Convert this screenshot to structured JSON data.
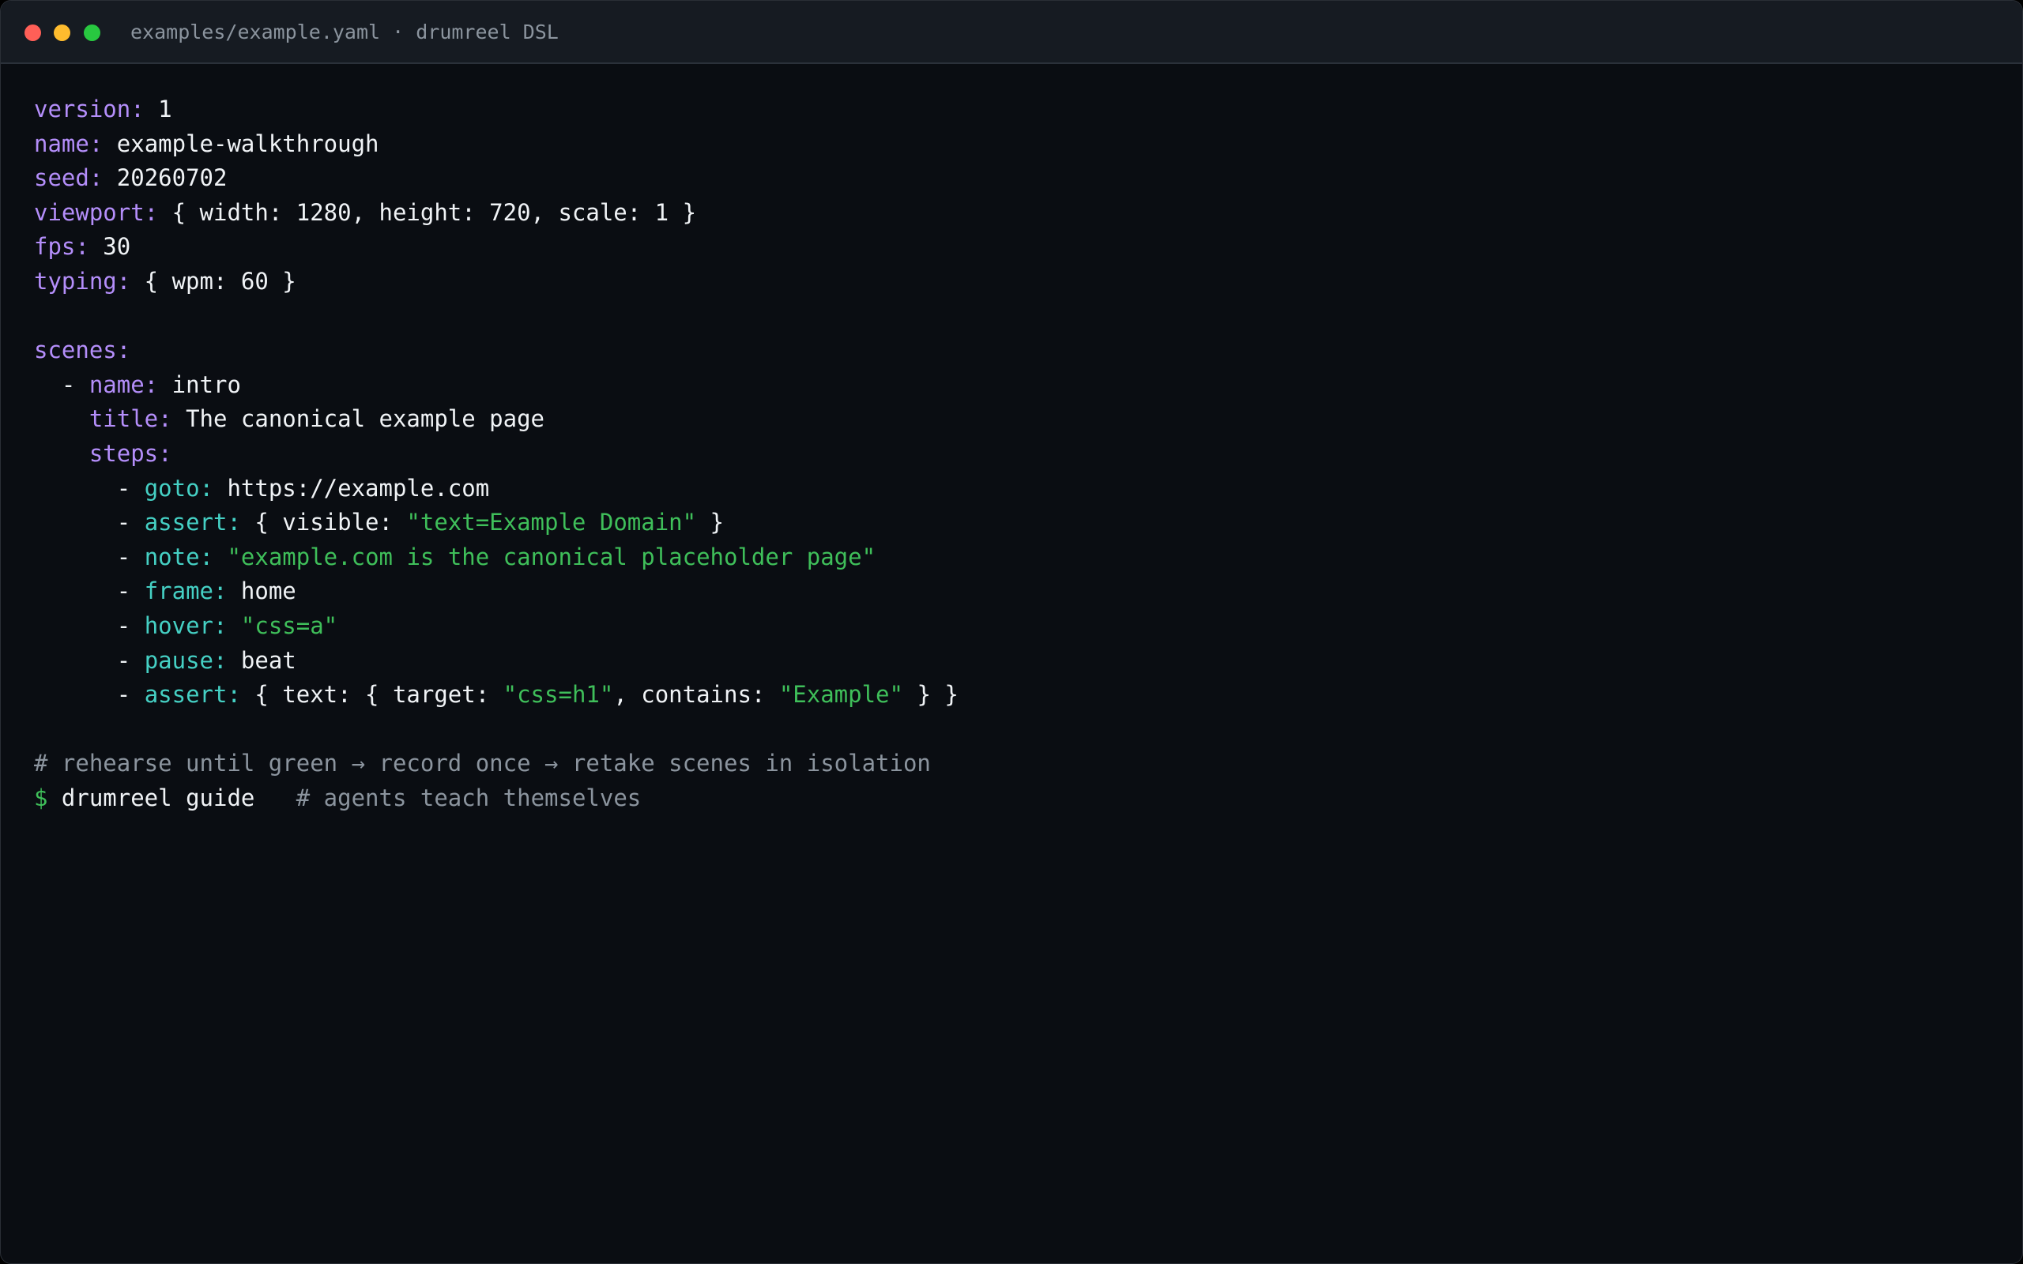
{
  "window": {
    "title": "examples/example.yaml · drumreel DSL"
  },
  "colors": {
    "background": "#0a0d12",
    "titlebar": "#161b22",
    "key": "#b48efa",
    "step_key": "#45d0c4",
    "string": "#3fbf5a",
    "value": "#f0f3f6",
    "comment": "#8b949e",
    "prompt": "#3fbf5a"
  },
  "lines": [
    {
      "indent": "",
      "key": "version:",
      "value": " 1"
    },
    {
      "indent": "",
      "key": "name:",
      "value": " example-walkthrough"
    },
    {
      "indent": "",
      "key": "seed:",
      "value": " 20260702"
    },
    {
      "indent": "",
      "key": "viewport:",
      "value": " { width: 1280, height: 720, scale: 1 }"
    },
    {
      "indent": "",
      "key": "fps:",
      "value": " 30"
    },
    {
      "indent": "",
      "key": "typing:",
      "value": " { wpm: 60 }"
    },
    {
      "blank": ""
    },
    {
      "indent": "",
      "key": "scenes:"
    },
    {
      "indent": "  - ",
      "key": "name:",
      "value": " intro"
    },
    {
      "indent": "    ",
      "key": "title:",
      "value": " The canonical example page"
    },
    {
      "indent": "    ",
      "key": "steps:"
    },
    {
      "indent": "      - ",
      "step": "goto:",
      "value": " https://example.com"
    },
    {
      "indent": "      - ",
      "step": "assert:",
      "v1": " { visible: ",
      "str1": "\"text=Example Domain\"",
      "v2": " }"
    },
    {
      "indent": "      - ",
      "step": "note:",
      "v1": " ",
      "str1": "\"example.com is the canonical placeholder page\""
    },
    {
      "indent": "      - ",
      "step": "frame:",
      "value": " home"
    },
    {
      "indent": "      - ",
      "step": "hover:",
      "v1": " ",
      "str1": "\"css=a\""
    },
    {
      "indent": "      - ",
      "step": "pause:",
      "value": " beat"
    },
    {
      "indent": "      - ",
      "step": "assert:",
      "v1": " { text: { target: ",
      "str1": "\"css=h1\"",
      "v2": ", contains: ",
      "str2": "\"Example\"",
      "v3": " } }"
    },
    {
      "blank": ""
    },
    {
      "comment": "# rehearse until green → record once → retake scenes in isolation"
    },
    {
      "prompt": "$",
      "command": " drumreel guide",
      "trailing_comment": "   # agents teach themselves"
    }
  ]
}
